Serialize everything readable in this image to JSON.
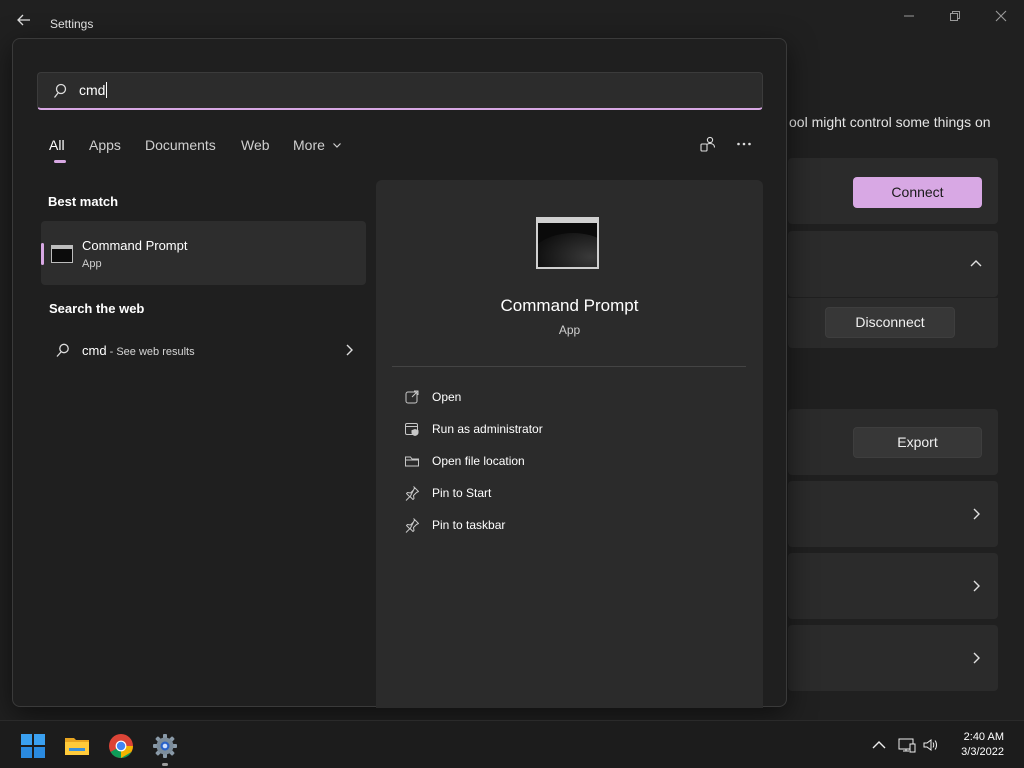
{
  "window": {
    "title": "Settings",
    "note_text": "ool might control some things on",
    "connect_label": "Connect",
    "disconnect_label": "Disconnect",
    "export_label": "Export"
  },
  "search": {
    "query": "cmd",
    "tabs": [
      {
        "label": "All",
        "active": true
      },
      {
        "label": "Apps"
      },
      {
        "label": "Documents"
      },
      {
        "label": "Web"
      },
      {
        "label": "More"
      }
    ]
  },
  "best_match": {
    "heading": "Best match",
    "name": "Command Prompt",
    "type": "App"
  },
  "web": {
    "heading": "Search the web",
    "query": "cmd",
    "suffix": " - See web results"
  },
  "detail": {
    "title": "Command Prompt",
    "type": "App",
    "actions": [
      {
        "label": "Open",
        "icon": "open-external-icon"
      },
      {
        "label": "Run as administrator",
        "icon": "shield-window-icon"
      },
      {
        "label": "Open file location",
        "icon": "folder-icon"
      },
      {
        "label": "Pin to Start",
        "icon": "pin-icon"
      },
      {
        "label": "Pin to taskbar",
        "icon": "pin-icon"
      }
    ]
  },
  "taskbar": {
    "apps": [
      "windows-start-icon",
      "file-explorer-icon",
      "chrome-icon",
      "settings-gear-icon"
    ],
    "time": "2:40 AM",
    "date": "3/3/2022"
  },
  "colors": {
    "accent": "#d8a8e4",
    "background": "#202020",
    "flyout": "#1f1f1f",
    "pane": "#2b2b2b"
  }
}
